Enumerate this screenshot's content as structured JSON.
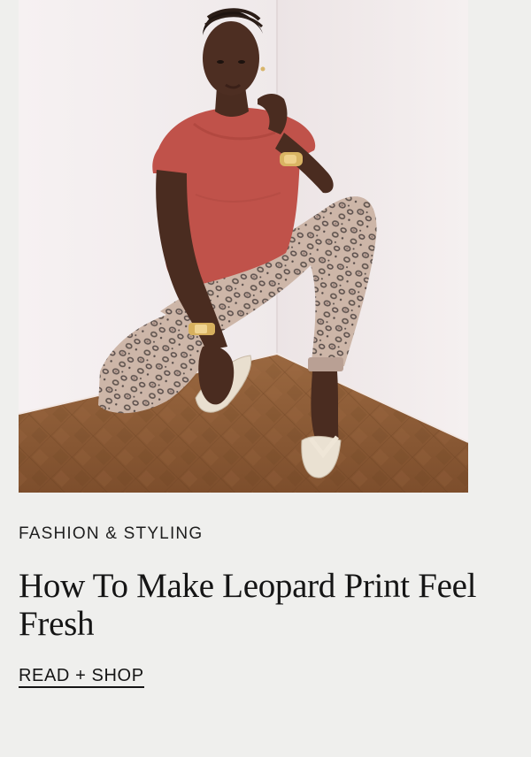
{
  "article": {
    "category": "FASHION & STYLING",
    "headline": "How To Make Leopard Print Feel Fresh",
    "cta_label": "READ + SHOP"
  },
  "photo": {
    "subject": "model-in-leopard-print-jeans-and-rust-top"
  },
  "colors": {
    "page_background": "#efefed",
    "text": "#151515",
    "top_color": "#c0524a",
    "floor_color": "#8b5a35"
  }
}
